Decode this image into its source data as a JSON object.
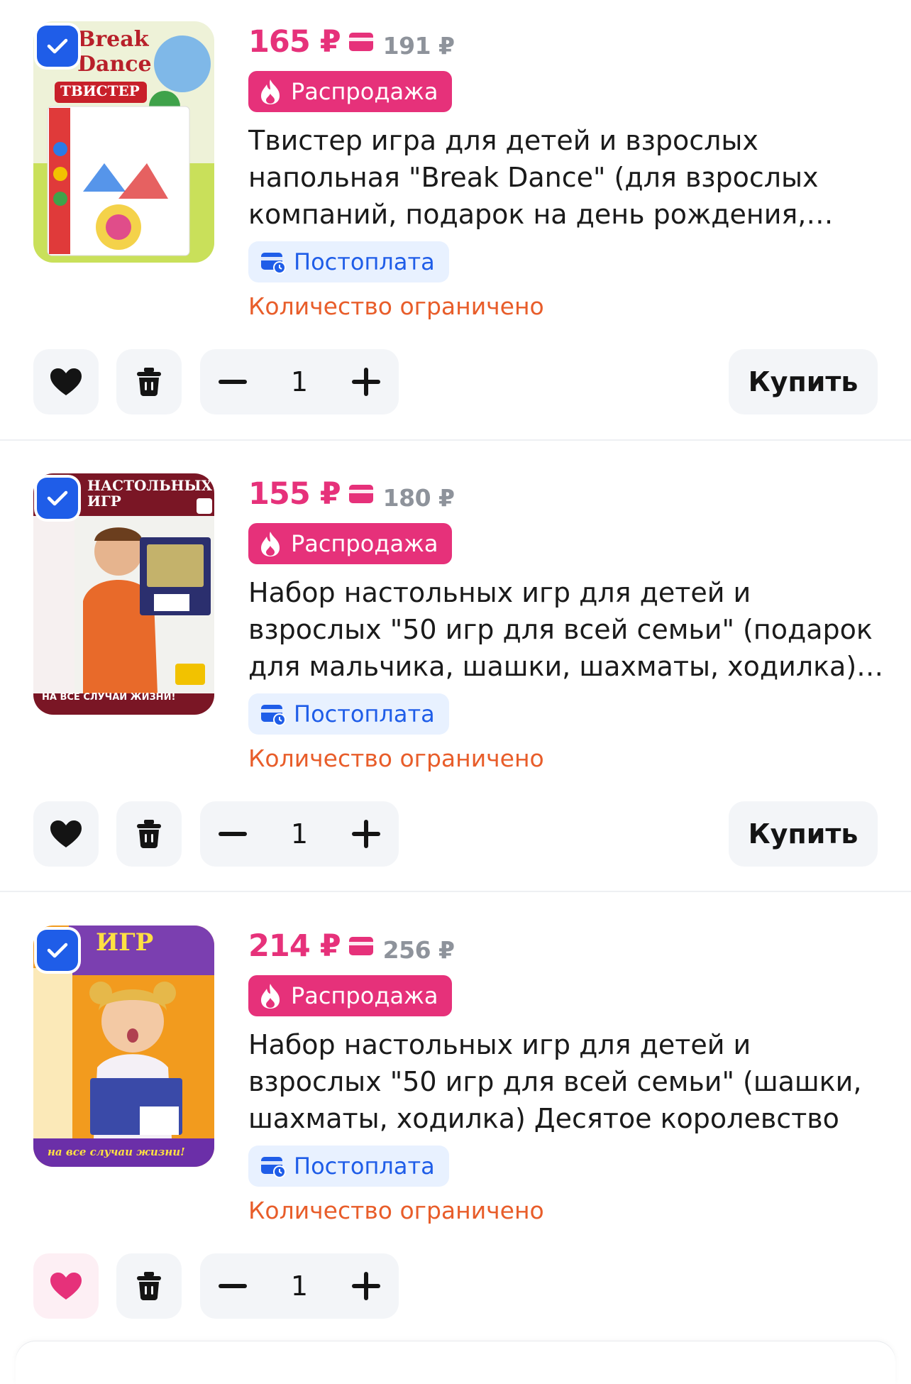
{
  "colors": {
    "accent_pink": "#e6317a",
    "checkbox_blue": "#1f5de8",
    "postpay_bg": "#e8f1ff",
    "limited_orange": "#e85d2a",
    "button_bg": "#f3f5f8"
  },
  "cart_items": [
    {
      "price": "165 ₽",
      "old_price": "191 ₽",
      "sale_label": "Распродажа",
      "title": "Твистер игра для детей и взрослых напольная \"Break Dance\" (для взрослых компаний, подарок на день рождения, для…",
      "postpay_label": "Постоплата",
      "limited_label": "Количество ограничено",
      "quantity": "1",
      "buy_label": "Купить",
      "checked": true,
      "favorited": false,
      "image_icon": "twister-game-box",
      "image_text": "Break Dance",
      "image_subtext": "ТВИСТЕР"
    },
    {
      "price": "155 ₽",
      "old_price": "180 ₽",
      "sale_label": "Распродажа",
      "title": "Набор настольных игр для детей и взрослых \"50 игр для всей семьи\" (подарок для мальчика, шашки, шахматы, ходилка) Десят…",
      "postpay_label": "Постоплата",
      "limited_label": "Количество ограничено",
      "quantity": "1",
      "buy_label": "Купить",
      "checked": true,
      "favorited": false,
      "image_icon": "board-games-box-boy",
      "image_text": "НАСТОЛЬНЫХ ИГР",
      "image_subtext": "НА ВСЕ СЛУЧАИ ЖИЗНИ!"
    },
    {
      "price": "214 ₽",
      "old_price": "256 ₽",
      "sale_label": "Распродажа",
      "title": "Набор настольных игр для детей и взрослых \"50 игр для всей семьи\" (шашки, шахматы, ходилка) Десятое королевство",
      "postpay_label": "Постоплата",
      "limited_label": "Количество ограничено",
      "quantity": "1",
      "checked": true,
      "favorited": true,
      "image_icon": "board-games-box-girl",
      "image_text": "ИГР",
      "image_subtext": "на все случаи жизни!"
    }
  ]
}
